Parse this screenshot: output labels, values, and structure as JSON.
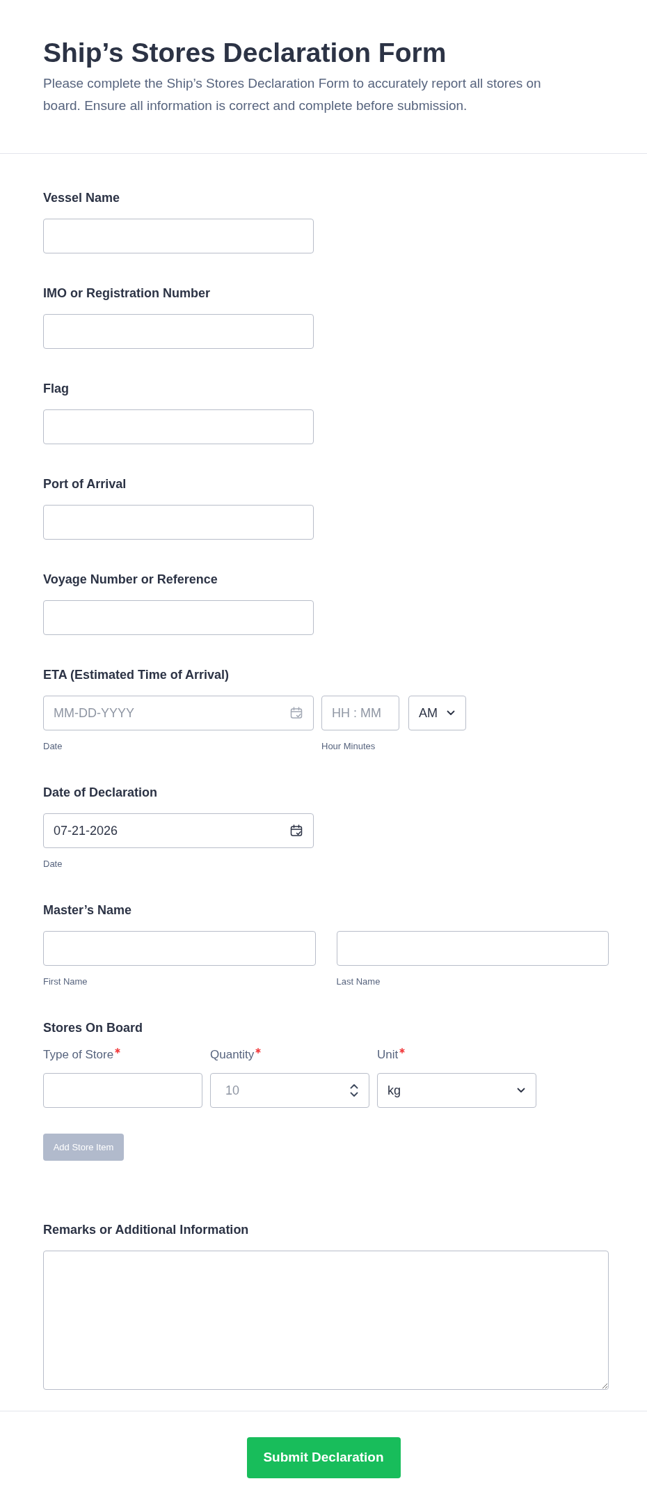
{
  "header": {
    "title": "Ship’s Stores Declaration Form",
    "description": "Please complete the Ship’s Stores Declaration Form to accurately report all stores on board. Ensure all information is correct and complete before submission."
  },
  "fields": [
    {
      "kind": "text",
      "label": "Vessel Name"
    },
    {
      "kind": "text",
      "label": "IMO or Registration Number"
    },
    {
      "kind": "text",
      "label": "Flag"
    },
    {
      "kind": "text",
      "label": "Port of Arrival"
    },
    {
      "kind": "text",
      "label": "Voyage Number or Reference"
    },
    {
      "kind": "datetime",
      "label": "ETA (Estimated Time of Arrival)",
      "date": {
        "placeholder": "MM-DD-YYYY",
        "sublabel": "Date"
      },
      "time": {
        "placeholder": "HH : MM",
        "sublabel": "Hour Minutes"
      },
      "period": "AM"
    },
    {
      "kind": "date",
      "label": "Date of Declaration",
      "value": "07-21-2026",
      "sublabel": "Date"
    },
    {
      "kind": "fullname",
      "label": "Master’s Name",
      "parts": [
        {
          "sublabel": "First Name"
        },
        {
          "sublabel": "Last Name"
        }
      ]
    },
    {
      "kind": "stores",
      "label": "Stores On Board",
      "columns": [
        {
          "kind": "text",
          "label": "Type of Store",
          "required": true
        },
        {
          "kind": "number",
          "label": "Quantity",
          "required": true,
          "placeholder": "10"
        },
        {
          "kind": "select",
          "label": "Unit",
          "required": true,
          "value": "kg"
        }
      ],
      "add_button": {
        "label": "Add Store Item",
        "disabled": true
      }
    },
    {
      "kind": "textarea",
      "label": "Remarks or Additional Information"
    }
  ],
  "submit": {
    "label": "Submit Declaration"
  }
}
